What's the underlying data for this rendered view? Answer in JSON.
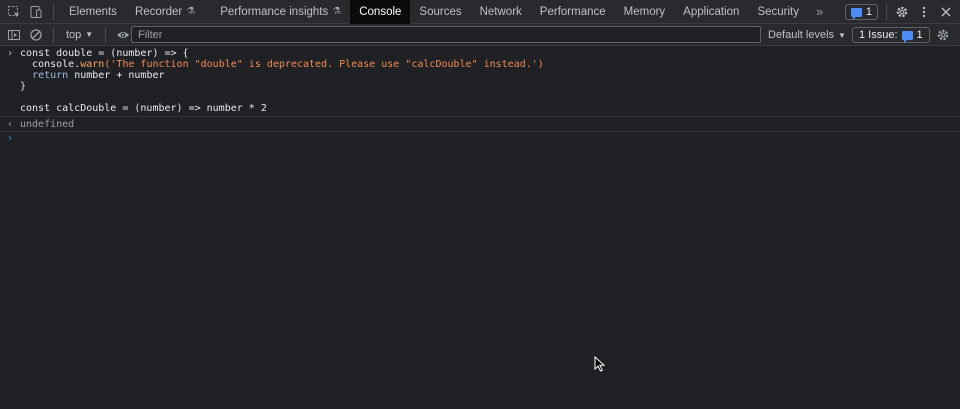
{
  "tabs": [
    {
      "label": "Elements",
      "active": false,
      "experimental": false
    },
    {
      "label": "Recorder",
      "active": false,
      "experimental": true
    },
    {
      "label": "Performance insights",
      "active": false,
      "experimental": true
    },
    {
      "label": "Console",
      "active": true,
      "experimental": false
    },
    {
      "label": "Sources",
      "active": false,
      "experimental": false
    },
    {
      "label": "Network",
      "active": false,
      "experimental": false
    },
    {
      "label": "Performance",
      "active": false,
      "experimental": false
    },
    {
      "label": "Memory",
      "active": false,
      "experimental": false
    },
    {
      "label": "Application",
      "active": false,
      "experimental": false
    },
    {
      "label": "Security",
      "active": false,
      "experimental": false
    }
  ],
  "tabbar": {
    "more_tabs_glyph": "»",
    "messages_count": "1",
    "icons": [
      "inspect-element-icon",
      "device-toolbar-icon",
      "settings-gear-icon",
      "more-vertical-icon",
      "close-icon"
    ]
  },
  "toolbar": {
    "context": "top",
    "filter_placeholder": "Filter",
    "levels": "Default levels",
    "issues_label": "1 Issue:",
    "issues_count": "1",
    "icons": [
      "sidebar-toggle-icon",
      "clear-console-icon",
      "live-expression-eye-icon",
      "console-settings-gear-icon"
    ]
  },
  "console": {
    "input_lines": [
      {
        "t1": "const double = (number) => {"
      },
      {
        "indent": "  ",
        "obj": "console.",
        "fn": "warn",
        "str": "('The function \"double\" is deprecated. Please use \"calcDouble\" instead.')"
      },
      {
        "indent": "  ",
        "kw": "return",
        "rest": " number + number"
      },
      {
        "t1": "}"
      },
      {
        "t1": ""
      },
      {
        "t1": "const calcDouble = (number) => number * 2"
      }
    ],
    "result": "undefined",
    "prompt_glyph": "›",
    "result_glyph": "‹"
  },
  "colors": {
    "background": "#202124",
    "toolbar": "#292a2d",
    "string": "#f28b54",
    "keyword": "#9bbbdc",
    "accent": "#4c8df6"
  }
}
